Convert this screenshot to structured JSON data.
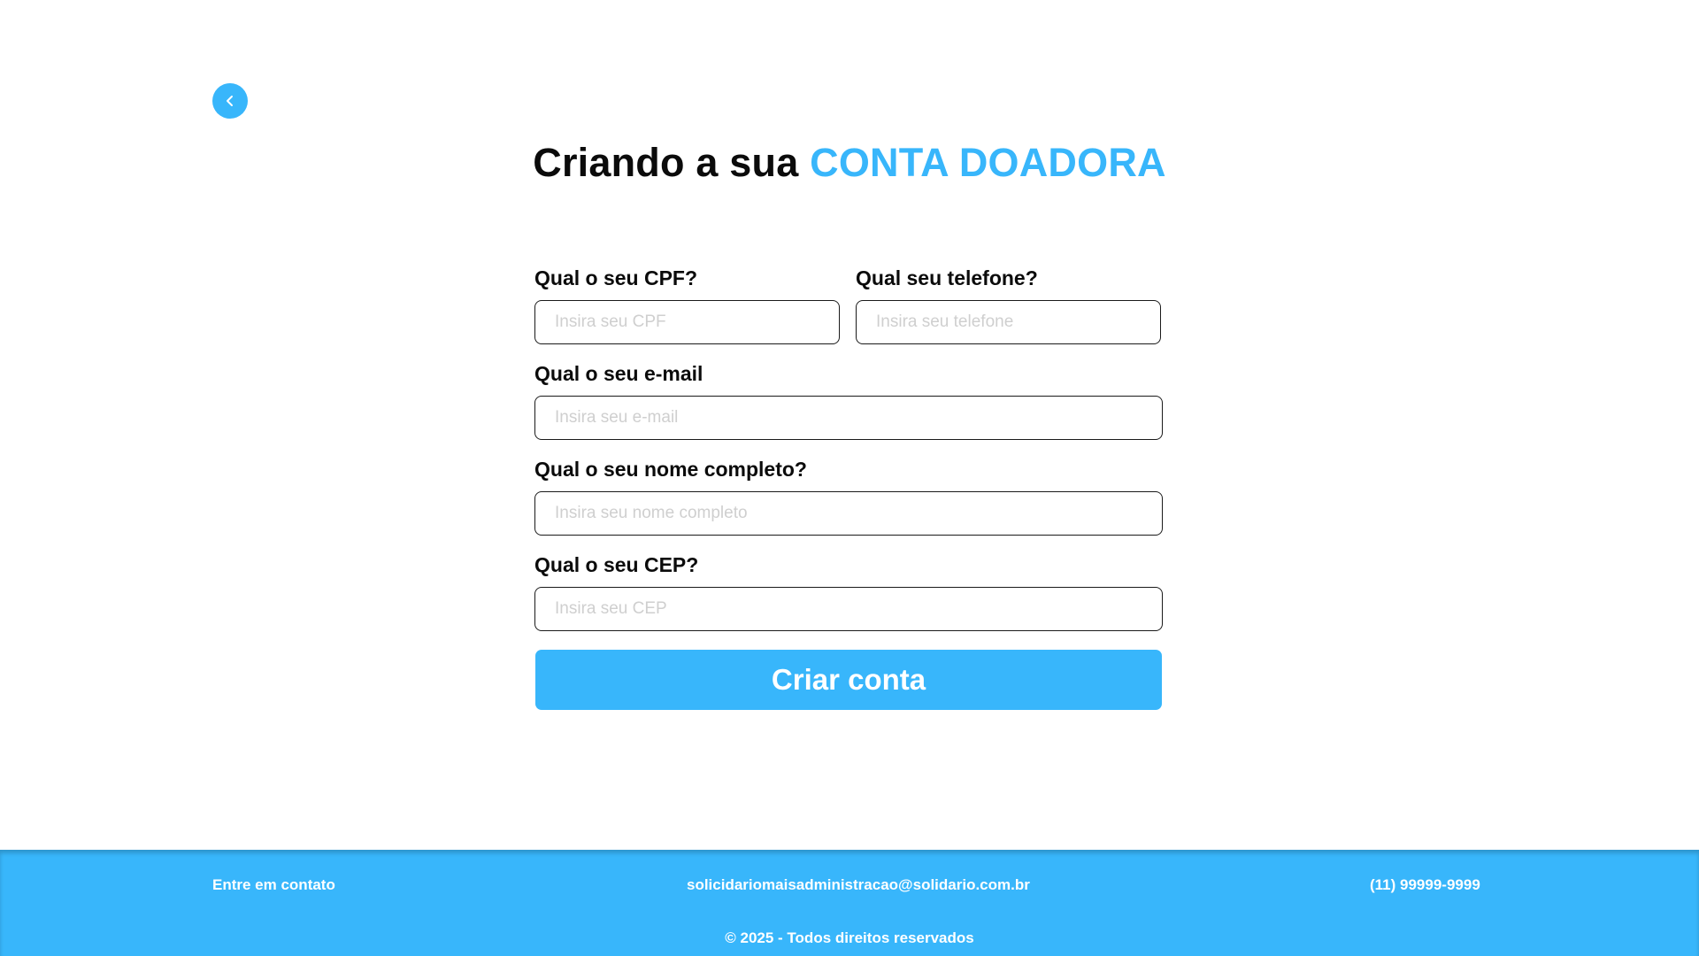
{
  "header": {
    "title_main": "Criando a sua ",
    "title_accent": "CONTA DOADORA"
  },
  "icons": {
    "back": "chevron-left-icon"
  },
  "colors": {
    "accent": "#38b6fb",
    "text": "#0b0b0b",
    "placeholder": "#cfcfcf",
    "background": "#ffffff"
  },
  "form": {
    "cpf": {
      "label": "Qual o seu CPF?",
      "placeholder": "Insira seu CPF",
      "value": ""
    },
    "phone": {
      "label": "Qual seu telefone?",
      "placeholder": "Insira seu telefone",
      "value": ""
    },
    "email": {
      "label": "Qual o seu e-mail",
      "placeholder": "Insira seu e-mail",
      "value": ""
    },
    "name": {
      "label": "Qual o seu nome completo?",
      "placeholder": "Insira seu nome completo",
      "value": ""
    },
    "cep": {
      "label": "Qual o seu CEP?",
      "placeholder": "Insira seu CEP",
      "value": ""
    },
    "submit_label": "Criar conta"
  },
  "footer": {
    "contact_label": "Entre em contato",
    "email": "solicidariomaisadministracao@solidario.com.br",
    "phone": "(11) 99999-9999",
    "copyright": "© 2025 - Todos direitos reservados"
  }
}
